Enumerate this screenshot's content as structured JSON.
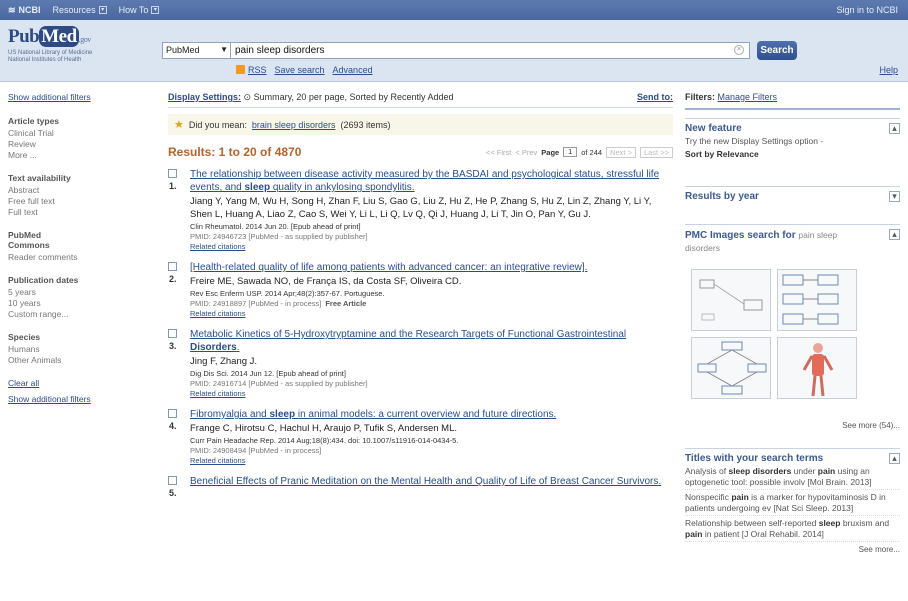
{
  "topbar": {
    "ncbi": "NCBI",
    "resources": "Resources",
    "howto": "How To",
    "signin": "Sign in to NCBI"
  },
  "header": {
    "logo_pub": "Pub",
    "logo_med": "Med",
    "logo_gov": ".gov",
    "logo_sub1": "US National Library of Medicine",
    "logo_sub2": "National Institutes of Health",
    "database": "PubMed",
    "query": "pain sleep disorders",
    "search_button": "Search",
    "rss": "RSS",
    "save_search": "Save search",
    "advanced": "Advanced",
    "help": "Help"
  },
  "sidebar": {
    "show_filters_top": "Show additional filters",
    "groups": [
      {
        "title": "Article types",
        "items": [
          "Clinical Trial",
          "Review",
          "More ..."
        ]
      },
      {
        "title": "Text availability",
        "items": [
          "Abstract",
          "Free full text",
          "Full text"
        ]
      },
      {
        "title": "PubMed Commons",
        "items": [
          "Reader comments"
        ]
      },
      {
        "title": "Publication dates",
        "items": [
          "5 years",
          "10 years",
          "Custom range..."
        ]
      },
      {
        "title": "Species",
        "items": [
          "Humans",
          "Other Animals"
        ]
      }
    ],
    "clear_all": "Clear all",
    "show_filters_bottom": "Show additional filters"
  },
  "main": {
    "display_label": "Display Settings:",
    "display_value": "Summary, 20 per page, Sorted by Recently Added",
    "send_to": "Send to:",
    "didyoumean_prefix": "Did you mean:",
    "didyoumean_link": "brain sleep disorders",
    "didyoumean_count": "(2693 items)",
    "results_title": "Results: 1 to 20 of 4870",
    "pager": {
      "first": "<< First",
      "prev": "< Prev",
      "page_label": "Page",
      "page": "1",
      "of": "of 244",
      "next": "Next >",
      "last": "Last >>"
    },
    "items": [
      {
        "num": "1.",
        "title_parts": [
          "The relationship between disease activity measured by the BASDAI and psychological status, stressful life events, and ",
          "sleep",
          " quality in ankylosing spondylitis."
        ],
        "authors": "Jiang Y, Yang M, Wu H, Song H, Zhan F, Liu S, Gao G, Liu Z, Hu Z, He P, Zhang S, Hu Z, Lin Z, Zhang Y, Li Y, Shen L, Huang A, Liao Z, Cao S, Wei Y, Li L, Li Q, Lv Q, Qi J, Huang J, Li T, Jin O, Pan Y, Gu J.",
        "journal": "Clin Rheumatol. 2014 Jun 20. [Epub ahead of print]",
        "pmid": "PMID: 24946723 [PubMed - as supplied by publisher]",
        "free": "",
        "related": "Related citations"
      },
      {
        "num": "2.",
        "title_parts": [
          "[Health-related quality of life among patients with advanced cancer: an integrative review]."
        ],
        "authors": "Freire ME, Sawada NO, de França IS, da Costa SF, Oliveira CD.",
        "journal": "Rev Esc Enferm USP. 2014 Apr;48(2):357-67. Portuguese.",
        "pmid": "PMID: 24918897 [PubMed - in process]",
        "free": "Free Article",
        "related": "Related citations"
      },
      {
        "num": "3.",
        "title_parts": [
          "Metabolic Kinetics of 5-Hydroxytryptamine and the Research Targets of Functional Gastrointestinal ",
          "Disorders",
          "."
        ],
        "authors": "Jing F, Zhang J.",
        "journal": "Dig Dis Sci. 2014 Jun 12. [Epub ahead of print]",
        "pmid": "PMID: 24916714 [PubMed - as supplied by publisher]",
        "free": "",
        "related": "Related citations"
      },
      {
        "num": "4.",
        "title_parts": [
          "Fibromyalgia and ",
          "sleep",
          " in animal models: a current overview and future directions."
        ],
        "authors": "Frange C, Hirotsu C, Hachul H, Araujo P, Tufik S, Andersen ML.",
        "journal": "Curr Pain Headache Rep. 2014 Aug;18(8):434. doi: 10.1007/s11916-014-0434-5.",
        "pmid": "PMID: 24908494 [PubMed - in process]",
        "free": "",
        "related": "Related citations"
      },
      {
        "num": "5.",
        "title_parts": [
          "Beneficial Effects of Pranic Meditation on the Mental Health and Quality of Life of Breast Cancer Survivors."
        ],
        "authors": "",
        "journal": "",
        "pmid": "",
        "free": "",
        "related": ""
      }
    ]
  },
  "right": {
    "filters_label": "Filters:",
    "manage_filters": "Manage Filters",
    "new_feature_title": "New feature",
    "new_feature_text": "Try the new Display Settings option -",
    "new_feature_bold": "Sort by Relevance",
    "results_by_year": "Results by year",
    "pmc_title": "PMC Images search for",
    "pmc_query": "pain sleep disorders",
    "see_more_images": "See more (54)...",
    "titles_title": "Titles with your search terms",
    "titles": [
      {
        "pre": "Analysis of ",
        "bold": "sleep disorders",
        "mid": " under ",
        "bold2": "pain",
        "post": " using an optogenetic tool: possible involv [Mol Brain. 2013]"
      },
      {
        "pre": "Nonspecific ",
        "bold": "pain",
        "mid": " is a marker for hypovitaminosis D in patients undergoing ev [Nat Sci Sleep. 2013]",
        "bold2": "",
        "post": ""
      },
      {
        "pre": "Relationship between self-reported ",
        "bold": "sleep",
        "mid": " bruxism and ",
        "bold2": "pain",
        "post": " in patient [J Oral Rehabil. 2014]"
      }
    ],
    "see_more_titles": "See more..."
  },
  "colors": {
    "topbar": "#4a67a0",
    "header": "#dbe4f1",
    "link": "#2a4d8f",
    "results_title": "#b8622a",
    "search_button": "#2f508e",
    "rss": "#f29a1f"
  }
}
